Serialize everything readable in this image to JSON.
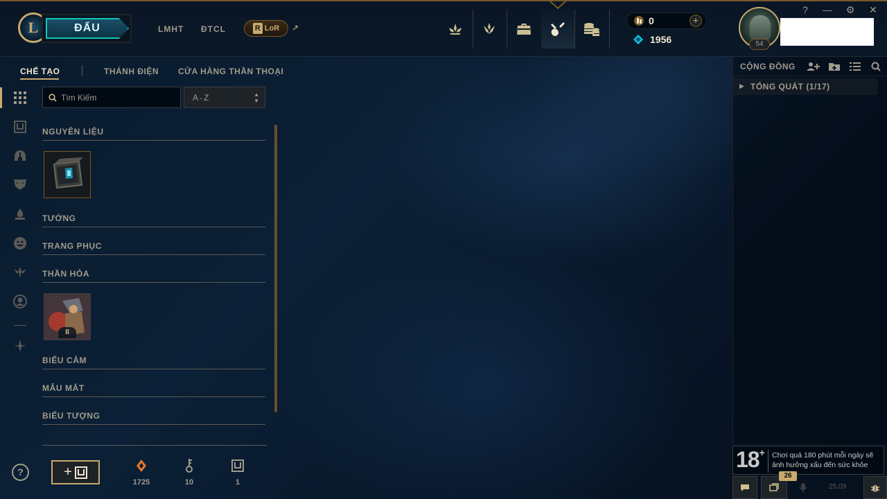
{
  "header": {
    "play_label": "ĐẤU",
    "links": [
      "LMHT",
      "ĐTCL"
    ],
    "lor_label": "LoR",
    "lor_letter": "R",
    "external_arrow": "↗",
    "nav_icons": [
      "home-icon",
      "tft-icon",
      "collection-icon",
      "loot-icon",
      "store-icon"
    ],
    "active_nav": "loot-icon",
    "currency": {
      "rp": "0",
      "blue_essence": "1956",
      "add": "+"
    },
    "profile": {
      "level": "54"
    },
    "window_controls": [
      "?",
      "—",
      "⚙",
      "✕"
    ]
  },
  "subnav": {
    "tabs": [
      "CHẾ TẠO",
      "THÁNH ĐIỆN",
      "CỬA HÀNG THẦN THOẠI"
    ],
    "active": "CHẾ TẠO"
  },
  "sidebar_icons": [
    "grid-icon",
    "chest-icon",
    "champion-helmet-icon",
    "skin-mask-icon",
    "ward-icon",
    "emote-icon",
    "eternals-icon",
    "summoner-icon",
    "other-icon"
  ],
  "loot": {
    "search_placeholder": "Tìm Kiếm",
    "sort_value": "A-Z",
    "sections": [
      {
        "label": "NGUYÊN LIỆU",
        "items": [
          "hextech-chest"
        ]
      },
      {
        "label": "TƯỚNG",
        "items": []
      },
      {
        "label": "TRANG PHỤC",
        "items": []
      },
      {
        "label": "THẦN HỎA",
        "items": [
          "eternals-series-2"
        ]
      },
      {
        "label": "BIỂU CẢM",
        "items": []
      },
      {
        "label": "MẪU MẮT",
        "items": []
      },
      {
        "label": "BIỂU TƯỢNG",
        "items": []
      }
    ],
    "eternal_badge": "II"
  },
  "footer": {
    "help": "?",
    "add_label": "+",
    "resources": [
      {
        "icon": "orange-essence-icon",
        "value": "1725",
        "color": "#e2772f"
      },
      {
        "icon": "key-fragment-icon",
        "value": "10",
        "color": "#a09b8c"
      },
      {
        "icon": "chest-icon",
        "value": "1",
        "color": "#a09b8c"
      }
    ]
  },
  "social": {
    "title": "CỘNG ĐỒNG",
    "icons": [
      "add-friend-icon",
      "add-folder-icon",
      "list-icon",
      "search-icon"
    ],
    "group_label": "TỔNG QUÁT (1/17)"
  },
  "warning": {
    "age": "18",
    "age_plus": "+",
    "text": "Chơi quá 180 phút mỗi ngày sẽ ảnh hưởng xấu đến sức khỏe"
  },
  "bottom_bar": {
    "badge": "26",
    "version": "25.09"
  },
  "colors": {
    "gold": "#c8aa6e",
    "gold_dark": "#785a28",
    "text": "#a09b8c",
    "teal": "#0ac8b9",
    "blue_essence": "#0acbe6"
  }
}
